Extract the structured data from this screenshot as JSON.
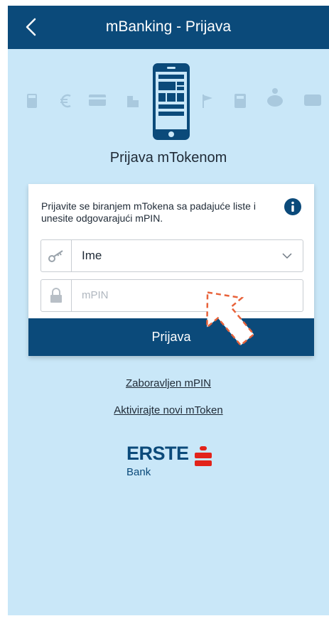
{
  "header": {
    "title": "mBanking - Prijava",
    "back_icon": "back-arrow-icon"
  },
  "section": {
    "title": "Prijava mTokenom"
  },
  "card": {
    "instruction": "Prijavite se biranjem mTokena sa padajuće liste i unesite odgovarajući mPIN.",
    "select": {
      "value": "Ime",
      "icon": "key-icon"
    },
    "pin": {
      "placeholder": "mPIN",
      "icon": "lock-icon"
    },
    "submit_label": "Prijava"
  },
  "links": {
    "forgot_pin": "Zaboravljen mPIN",
    "activate_token": "Aktivirajte novi mToken"
  },
  "brand": {
    "name": "ERSTE",
    "sub": "Bank"
  },
  "colors": {
    "primary": "#0b4a7a",
    "background": "#c9e7f8",
    "accent": "#e2231a",
    "cursor": "#e8623a"
  }
}
